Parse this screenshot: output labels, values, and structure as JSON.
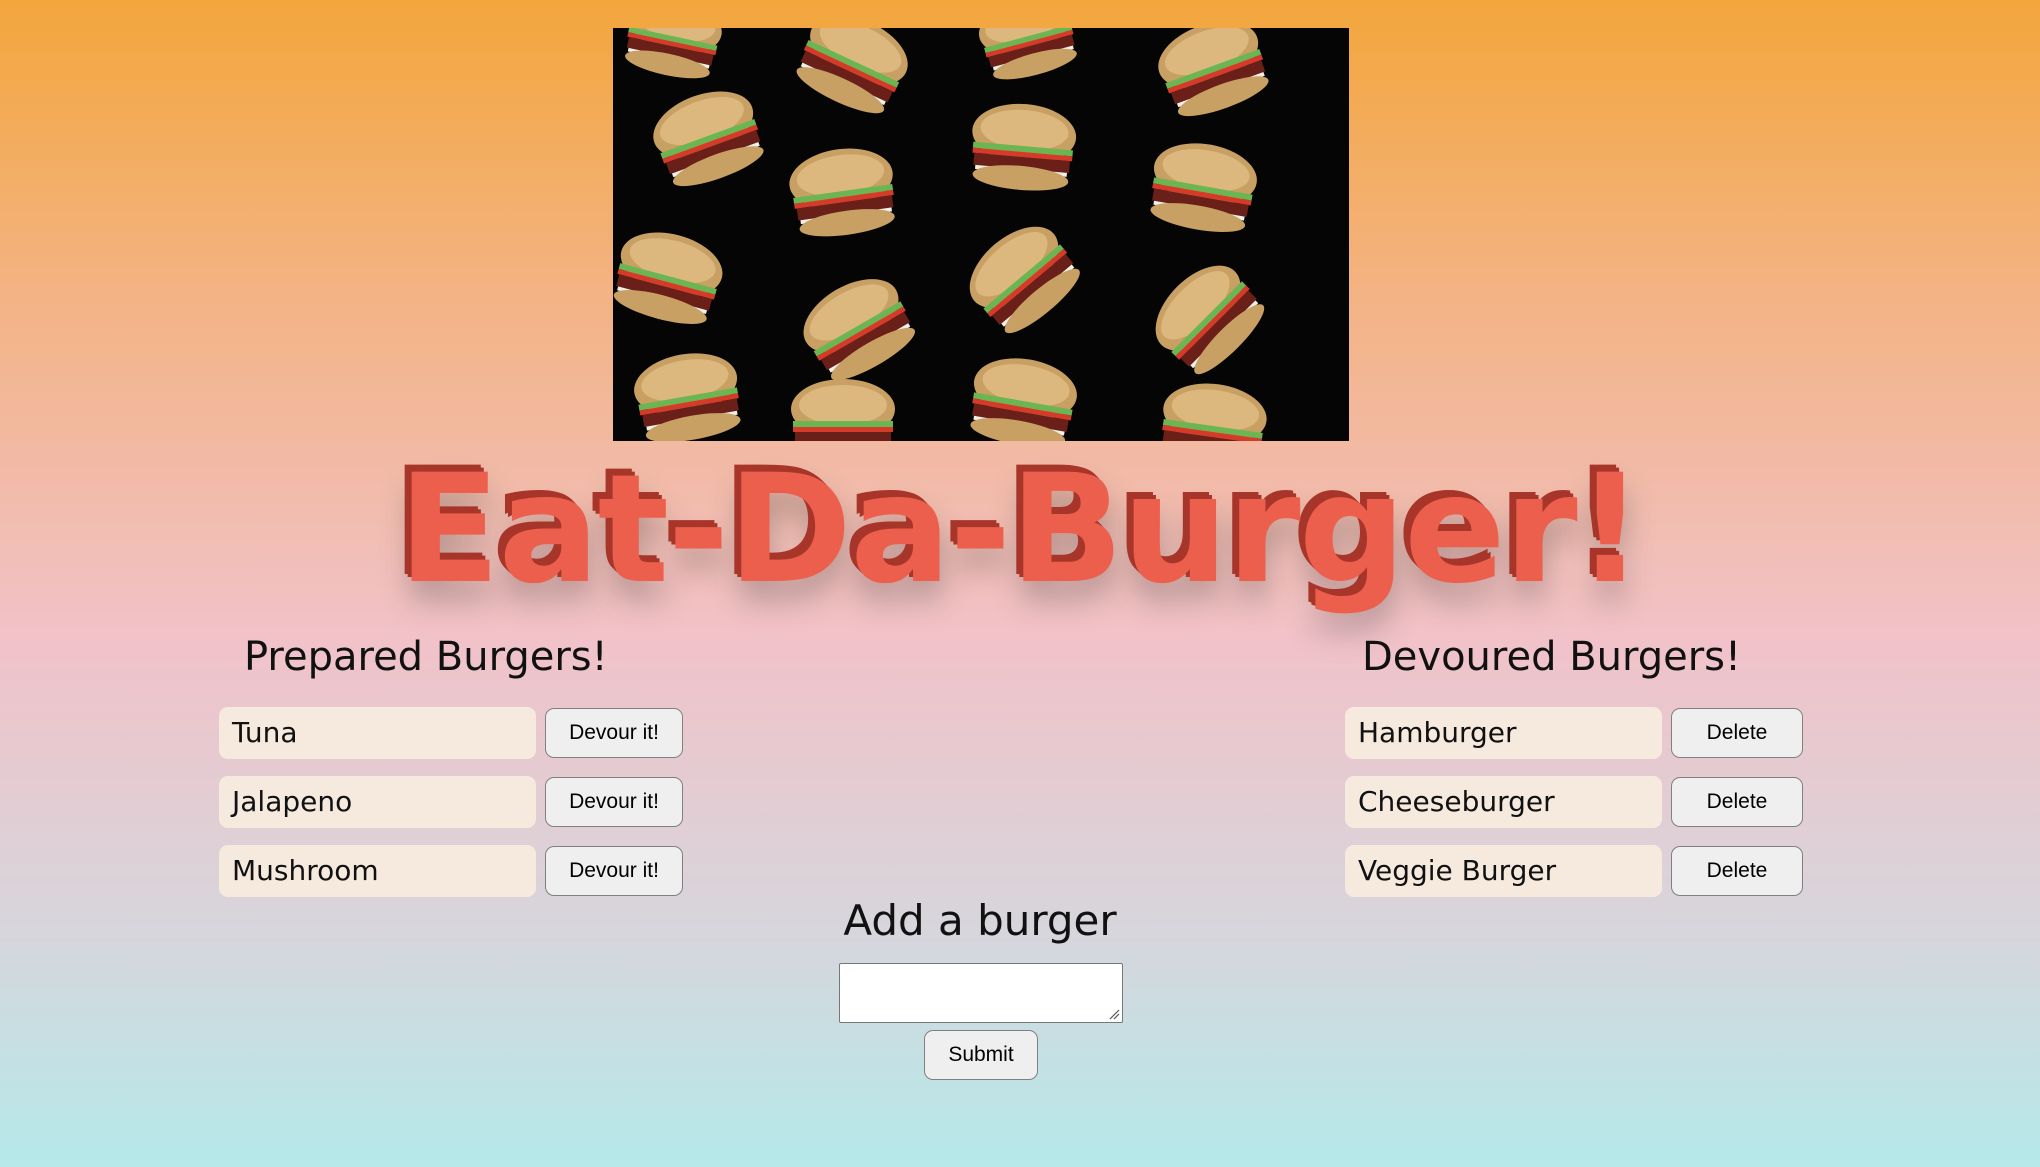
{
  "title": "Eat-Da-Burger!",
  "prepared": {
    "heading": "Prepared Burgers!",
    "items": [
      {
        "name": "Tuna",
        "action": "Devour it!"
      },
      {
        "name": "Jalapeno",
        "action": "Devour it!"
      },
      {
        "name": "Mushroom",
        "action": "Devour it!"
      }
    ]
  },
  "devoured": {
    "heading": "Devoured Burgers!",
    "items": [
      {
        "name": "Hamburger",
        "action": "Delete"
      },
      {
        "name": "Cheeseburger",
        "action": "Delete"
      },
      {
        "name": "Veggie Burger",
        "action": "Delete"
      }
    ]
  },
  "add": {
    "heading": "Add a burger",
    "input_value": "",
    "submit_label": "Submit"
  },
  "colors": {
    "title": "#ec5f4c",
    "title_shadow": "#a8352a",
    "item_bg": "#f6eadf"
  }
}
